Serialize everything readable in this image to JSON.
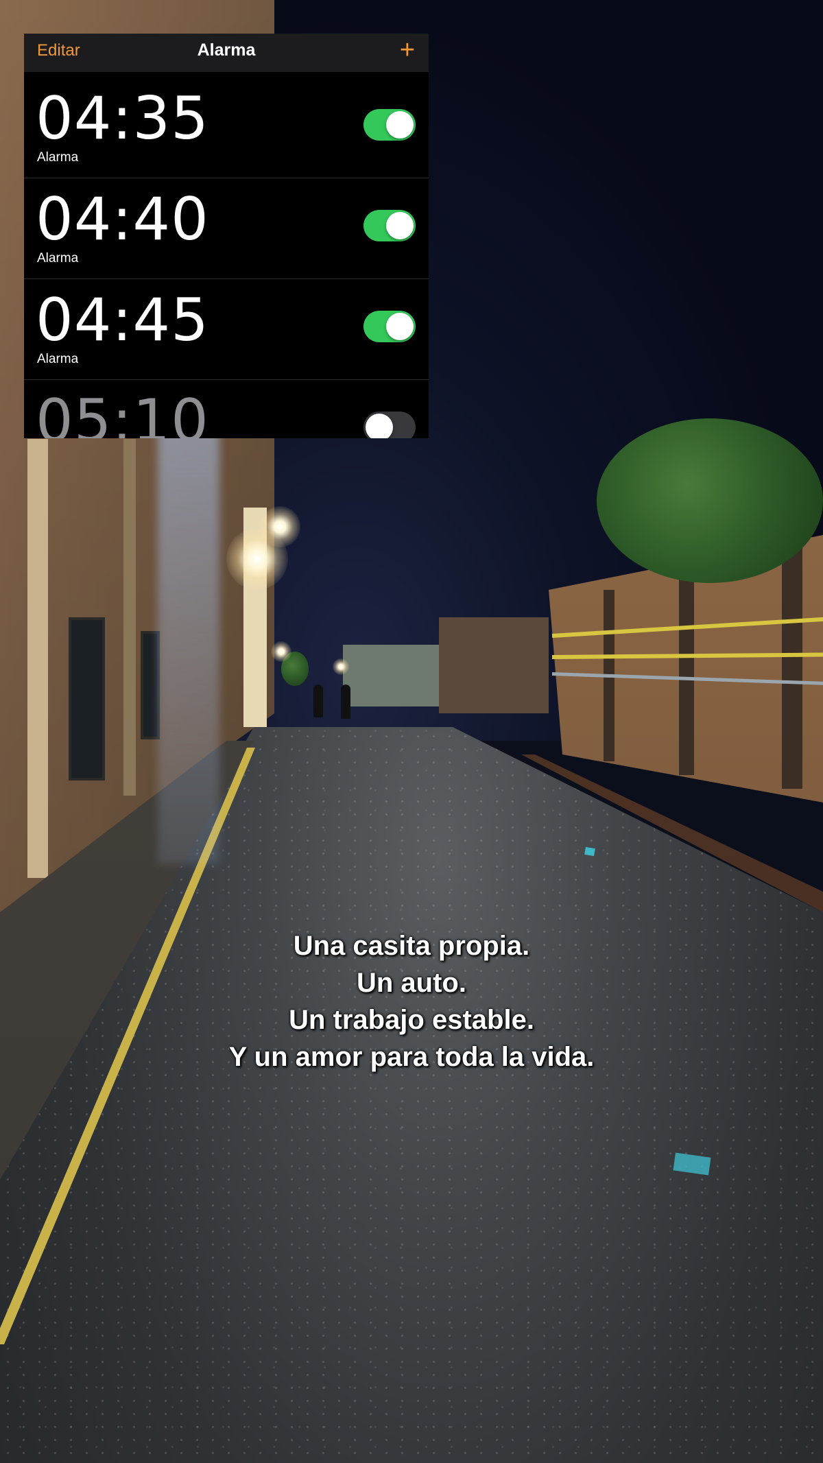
{
  "alarm_app": {
    "header": {
      "edit_label": "Editar",
      "title": "Alarma",
      "add_label": "+"
    },
    "alarms": [
      {
        "time": "04:35",
        "label": "Alarma",
        "enabled": true
      },
      {
        "time": "04:40",
        "label": "Alarma",
        "enabled": true
      },
      {
        "time": "04:45",
        "label": "Alarma",
        "enabled": true
      },
      {
        "time": "05:10",
        "label": "",
        "enabled": false
      }
    ],
    "colors": {
      "accent": "#f09a37",
      "toggle_on": "#34c759",
      "toggle_off": "#39393d",
      "background": "#000000"
    }
  },
  "caption": {
    "lines": [
      "Una casita propia.",
      "Un auto.",
      "Un trabajo estable.",
      "Y un amor para toda la vida."
    ]
  }
}
